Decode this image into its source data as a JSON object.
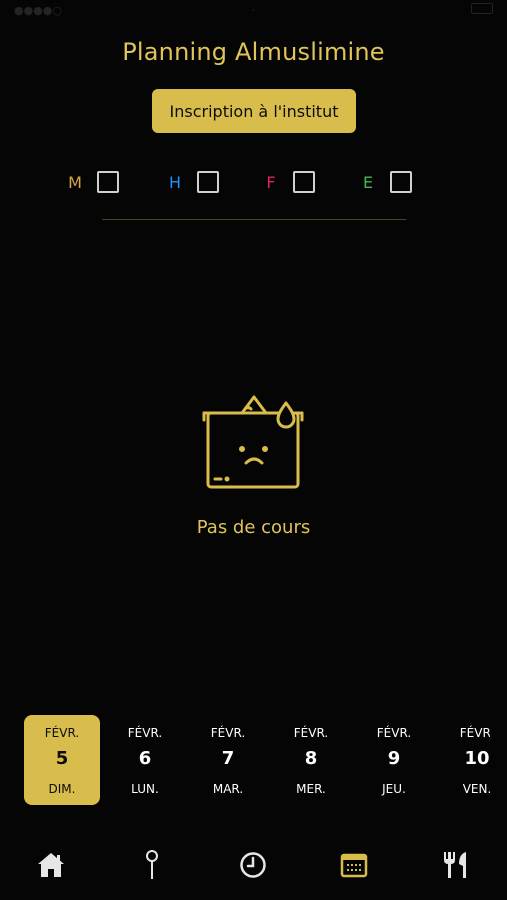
{
  "header": {
    "title": "Planning Almuslimine",
    "register_label": "Inscription à l'institut"
  },
  "filters": [
    {
      "label": "M",
      "color": "#d9a441",
      "checked": false
    },
    {
      "label": "H",
      "color": "#1e90ff",
      "checked": false
    },
    {
      "label": "F",
      "color": "#e0245e",
      "checked": false
    },
    {
      "label": "E",
      "color": "#3fb950",
      "checked": false
    }
  ],
  "empty_state": {
    "icon": "sad-board-icon",
    "text": "Pas de cours"
  },
  "dates": [
    {
      "month": "FÉVR.",
      "day": "5",
      "weekday": "DIM.",
      "selected": true
    },
    {
      "month": "FÉVR.",
      "day": "6",
      "weekday": "LUN.",
      "selected": false
    },
    {
      "month": "FÉVR.",
      "day": "7",
      "weekday": "MAR.",
      "selected": false
    },
    {
      "month": "FÉVR.",
      "day": "8",
      "weekday": "MER.",
      "selected": false
    },
    {
      "month": "FÉVR.",
      "day": "9",
      "weekday": "JEU.",
      "selected": false
    },
    {
      "month": "FÉVR.",
      "day": "10",
      "weekday": "VEN.",
      "selected": false
    }
  ],
  "tabs": [
    {
      "icon": "home-icon",
      "active": false
    },
    {
      "icon": "pin-icon",
      "active": false
    },
    {
      "icon": "clock-icon",
      "active": false
    },
    {
      "icon": "calendar-icon",
      "active": true
    },
    {
      "icon": "restaurant-icon",
      "active": false
    }
  ],
  "colors": {
    "accent": "#d9bd4c",
    "background": "#050505",
    "tab_inactive": "#e6e6e6"
  }
}
